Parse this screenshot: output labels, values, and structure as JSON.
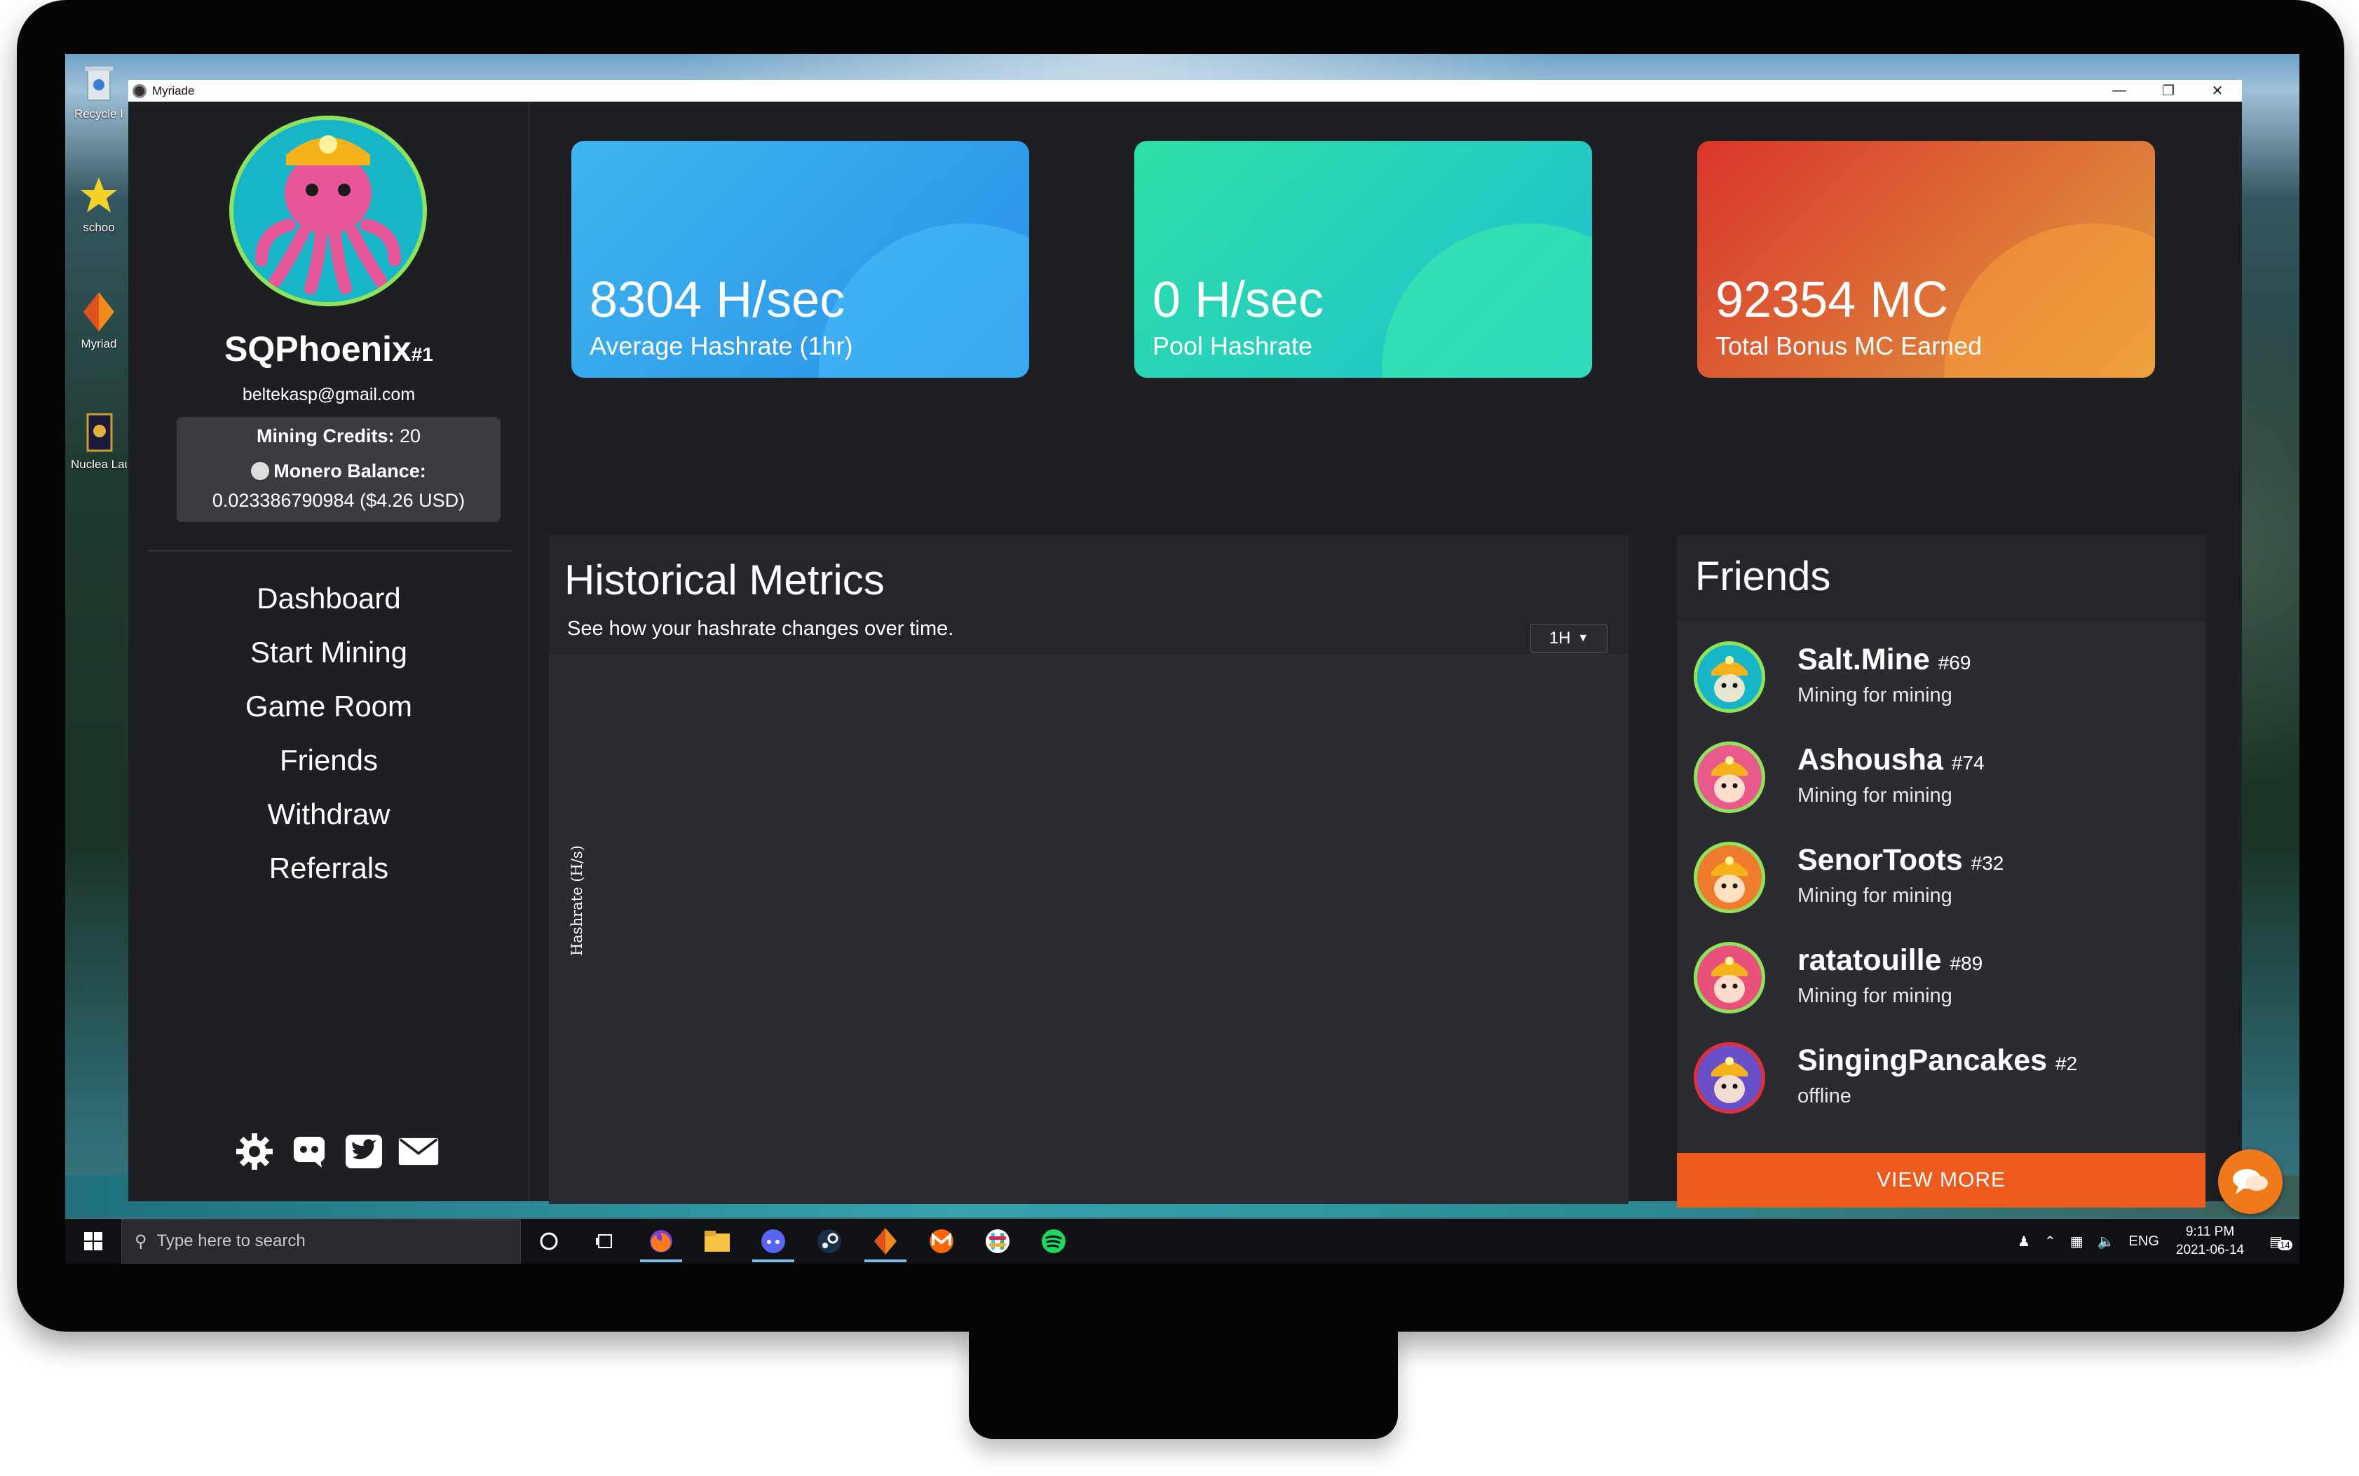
{
  "window": {
    "title": "Myriade"
  },
  "desktop": {
    "icons": [
      {
        "label": "Recycle I"
      },
      {
        "label": "schoo"
      },
      {
        "label": "Myriad"
      },
      {
        "label": "Nuclea Launc"
      }
    ]
  },
  "profile": {
    "username": "SQPhoenix",
    "rank": "#1",
    "email": "beltekasp@gmail.com",
    "credits_label": "Mining Credits:",
    "credits_value": "20",
    "monero_label": "Monero Balance:",
    "monero_value": "0.023386790984 ($4.26 USD)"
  },
  "nav": {
    "items": [
      {
        "label": "Dashboard"
      },
      {
        "label": "Start Mining"
      },
      {
        "label": "Game Room"
      },
      {
        "label": "Friends"
      },
      {
        "label": "Withdraw"
      },
      {
        "label": "Referrals"
      }
    ]
  },
  "sidebar_icons": [
    "gear-icon",
    "discord-icon",
    "twitter-icon",
    "mail-icon"
  ],
  "stats": [
    {
      "value": "8304 H/sec",
      "label": "Average Hashrate (1hr)",
      "colors": [
        "#3fb6ee",
        "#2a8fe8"
      ]
    },
    {
      "value": "0 H/sec",
      "label": "Pool Hashrate",
      "colors": [
        "#2ee0a6",
        "#1fbfd1"
      ]
    },
    {
      "value": "92354 MC",
      "label": "Total Bonus MC Earned",
      "colors": [
        "#d9352c",
        "#e0a040"
      ]
    }
  ],
  "metrics": {
    "title": "Historical Metrics",
    "subtitle": "See how your hashrate changes over time.",
    "range": "1H",
    "ylabel": "Hashrate (H/s)"
  },
  "friends": {
    "title": "Friends",
    "list": [
      {
        "name": "Salt.Mine",
        "tag": "#69",
        "status": "Mining for mining",
        "avatar_color": "#17b5c8",
        "ring": "#8fe35a"
      },
      {
        "name": "Ashousha",
        "tag": "#74",
        "status": "Mining for mining",
        "avatar_color": "#e85a8c",
        "ring": "#8fe35a"
      },
      {
        "name": "SenorToots",
        "tag": "#32",
        "status": "Mining for mining",
        "avatar_color": "#ef7d2d",
        "ring": "#8fe35a"
      },
      {
        "name": "ratatouille",
        "tag": "#89",
        "status": "Mining for mining",
        "avatar_color": "#e8527a",
        "ring": "#8fe35a"
      },
      {
        "name": "SingingPancakes",
        "tag": "#2",
        "status": "offline",
        "avatar_color": "#6a50c8",
        "ring": "#e0303a"
      }
    ],
    "view_more": "VIEW MORE"
  },
  "taskbar": {
    "search_placeholder": "Type here to search",
    "lang": "ENG",
    "time": "9:11 PM",
    "date": "2021-06-14",
    "notifications": "14"
  },
  "accent": "#ec5a1c"
}
